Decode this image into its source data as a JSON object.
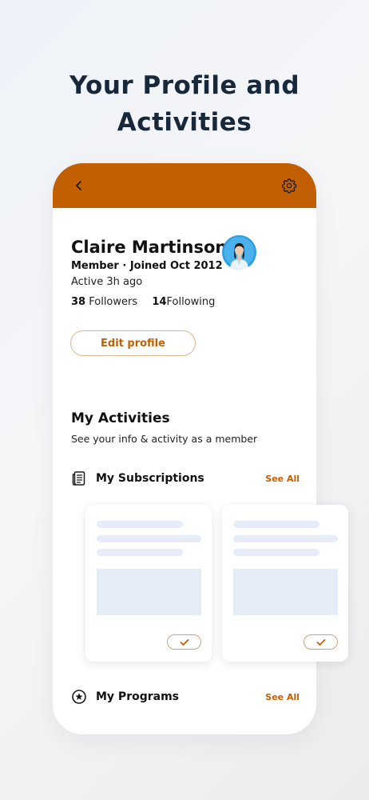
{
  "headline": {
    "line1": "Your Profile and",
    "line2": "Activities"
  },
  "colors": {
    "brand": "#c35f03",
    "headline": "#17283b",
    "placeholder": "#e6edf8"
  },
  "icons": {
    "back": "chevron-left-icon",
    "settings": "gear-icon",
    "subscriptions": "newspaper-icon",
    "programs": "star-circle-icon",
    "check": "check-icon"
  },
  "profile": {
    "name": "Claire Martinson",
    "member_line": "Member · Joined Oct 2012",
    "active": "Active 3h ago",
    "followers_count": "38",
    "followers_label": "Followers",
    "following_count": "14",
    "following_label": "Following",
    "edit_label": "Edit profile"
  },
  "activities": {
    "title": "My Activities",
    "subtitle": "See your info & activity as a member",
    "subscriptions": {
      "label": "My Subscriptions",
      "see_all": "See All"
    },
    "programs": {
      "label": "My Programs",
      "see_all": "See All"
    }
  }
}
